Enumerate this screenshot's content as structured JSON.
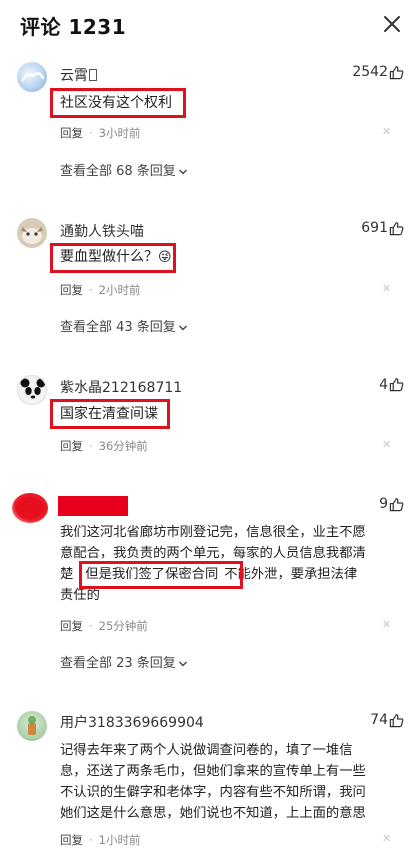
{
  "header": {
    "title": "评论 1231",
    "close_icon": "close-icon"
  },
  "comments": [
    {
      "username": "云霄",
      "likes": "2542",
      "text": "社区没有这个权利",
      "reply_label": "回复",
      "time": "3小时前",
      "view_all": "查看全部 68 条回复",
      "avatar_icon": "avatar-cloud"
    },
    {
      "username": "通勤人铁头喵",
      "likes": "691",
      "text": "要血型做什么？",
      "emoji": "😜",
      "reply_label": "回复",
      "time": "2小时前",
      "view_all": "查看全部 43 条回复",
      "avatar_icon": "avatar-cat"
    },
    {
      "username": "紫水晶212168711",
      "likes": "4",
      "text": "国家在清查间谍",
      "reply_label": "回复",
      "time": "36分钟前",
      "avatar_icon": "avatar-panda"
    },
    {
      "username_redacted": true,
      "likes": "9",
      "text_lines": [
        "我们这河北省廊坊市刚登记完，信息很全，业主不愿",
        "意配合，我负责的两个单元，每家的人员信息我都清",
        "楚",
        "但是我们签了保密合同",
        "不能外泄，要承担法律",
        "责任的"
      ],
      "reply_label": "回复",
      "time": "25分钟前",
      "view_all": "查看全部 23 条回复",
      "avatar_icon": "avatar-red"
    },
    {
      "username": "用户3183369669904",
      "likes": "74",
      "text_lines": [
        "记得去年来了两个人说做调查问卷的，填了一堆信",
        "息，还送了两条毛巾，但她们拿来的宣传单上有一些",
        "不认识的生僻字和老体字，内容有些不知所谓，我问",
        "她们这是什么意思，她们说也不知道，上上面的意思"
      ],
      "reply_label": "回复",
      "time": "1小时前",
      "avatar_icon": "avatar-green"
    }
  ],
  "colors": {
    "highlight": "#e0101e",
    "redact": "#e8001c",
    "meta": "#888888"
  }
}
